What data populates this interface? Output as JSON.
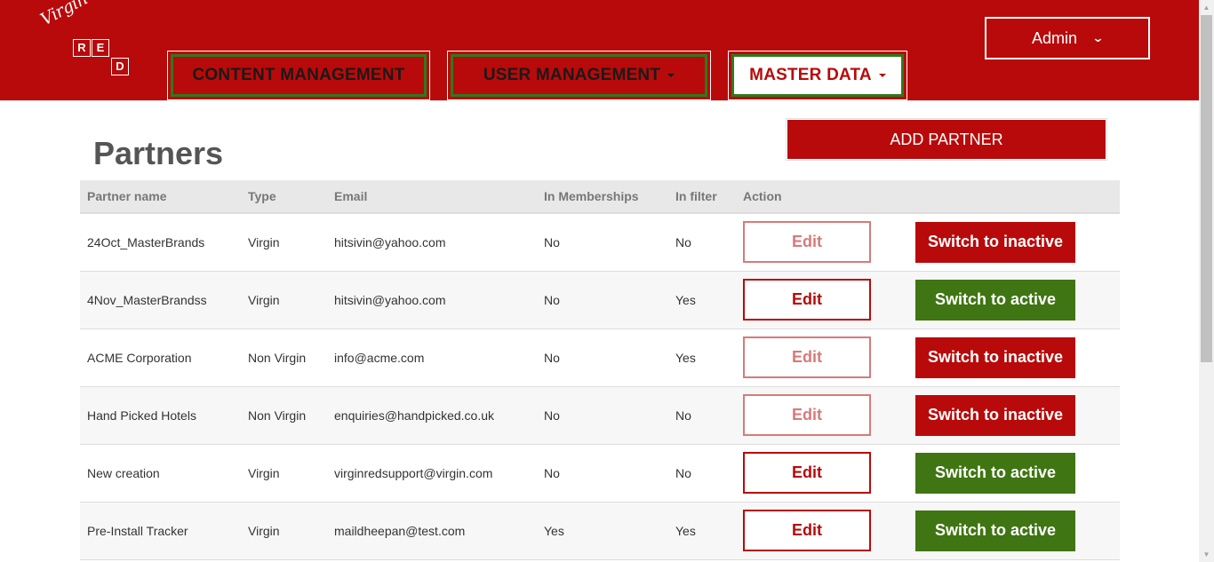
{
  "header": {
    "logo": {
      "script": "Virgin",
      "letters": [
        "R",
        "E",
        "D"
      ]
    },
    "nav": [
      {
        "label": "CONTENT MANAGEMENT",
        "has_dropdown": false,
        "active": false
      },
      {
        "label": "USER MANAGEMENT",
        "has_dropdown": true,
        "active": false
      },
      {
        "label": "MASTER DATA",
        "has_dropdown": true,
        "active": true
      }
    ],
    "admin_label": "Admin"
  },
  "main": {
    "title": "Partners",
    "add_button_label": "ADD PARTNER",
    "table": {
      "columns": [
        "Partner name",
        "Type",
        "Email",
        "In Memberships",
        "In filter",
        "Action"
      ],
      "rows": [
        {
          "name": "24Oct_MasterBrands",
          "type": "Virgin",
          "email": "hitsivin@yahoo.com",
          "in_memberships": "No",
          "in_filter": "No",
          "edit_label": "Edit",
          "edit_enabled": false,
          "switch_label": "Switch to inactive",
          "switch_kind": "inactive"
        },
        {
          "name": "4Nov_MasterBrandss",
          "type": "Virgin",
          "email": "hitsivin@yahoo.com",
          "in_memberships": "No",
          "in_filter": "Yes",
          "edit_label": "Edit",
          "edit_enabled": true,
          "switch_label": "Switch to active",
          "switch_kind": "active"
        },
        {
          "name": "ACME Corporation",
          "type": "Non Virgin",
          "email": "info@acme.com",
          "in_memberships": "No",
          "in_filter": "Yes",
          "edit_label": "Edit",
          "edit_enabled": false,
          "switch_label": "Switch to inactive",
          "switch_kind": "inactive"
        },
        {
          "name": "Hand Picked Hotels",
          "type": "Non Virgin",
          "email": "enquiries@handpicked.co.uk",
          "in_memberships": "No",
          "in_filter": "No",
          "edit_label": "Edit",
          "edit_enabled": false,
          "switch_label": "Switch to inactive",
          "switch_kind": "inactive"
        },
        {
          "name": "New creation",
          "type": "Virgin",
          "email": "virginredsupport@virgin.com",
          "in_memberships": "No",
          "in_filter": "No",
          "edit_label": "Edit",
          "edit_enabled": true,
          "switch_label": "Switch to active",
          "switch_kind": "active"
        },
        {
          "name": "Pre-Install Tracker",
          "type": "Virgin",
          "email": "maildheepan@test.com",
          "in_memberships": "Yes",
          "in_filter": "Yes",
          "edit_label": "Edit",
          "edit_enabled": true,
          "switch_label": "Switch to active",
          "switch_kind": "active"
        }
      ]
    }
  },
  "colors": {
    "brand_red": "#b80a0a",
    "active_green": "#3f7512",
    "nav_border_green": "#2d7a1e",
    "disabled_edit": "#d87a7a"
  },
  "icons": {
    "admin_dropdown": "chevron-down-icon",
    "nav_dropdown": "caret-down-icon"
  }
}
